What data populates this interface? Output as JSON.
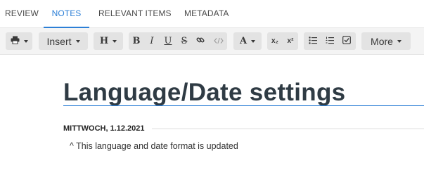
{
  "tabs": [
    {
      "label": "REVIEW"
    },
    {
      "label": "NOTES"
    },
    {
      "label": "RELEVANT ITEMS"
    },
    {
      "label": "METADATA"
    }
  ],
  "active_tab": "NOTES",
  "toolbar": {
    "print_icon": "printer-icon",
    "insert_label": "Insert",
    "heading_label": "H",
    "bold_label": "B",
    "italic_label": "I",
    "underline_label": "U",
    "strike_label": "S",
    "link_icon": "link-icon",
    "code_icon": "code-icon",
    "font_color_label": "A",
    "subscript_label": "x₂",
    "superscript_label": "x²",
    "bullet_list_icon": "bullet-list-icon",
    "numbered_list_icon": "numbered-list-icon",
    "checklist_icon": "checklist-icon",
    "more_label": "More"
  },
  "note": {
    "title": "Language/Date settings",
    "date": "MITTWOCH, 1.12.2021",
    "body": "^ This language and date format is updated"
  },
  "colors": {
    "accent": "#2c7fd6",
    "toolbar_bg": "#f4f4f4",
    "button_bg": "#e3e3e3",
    "title": "#2f3b44"
  }
}
